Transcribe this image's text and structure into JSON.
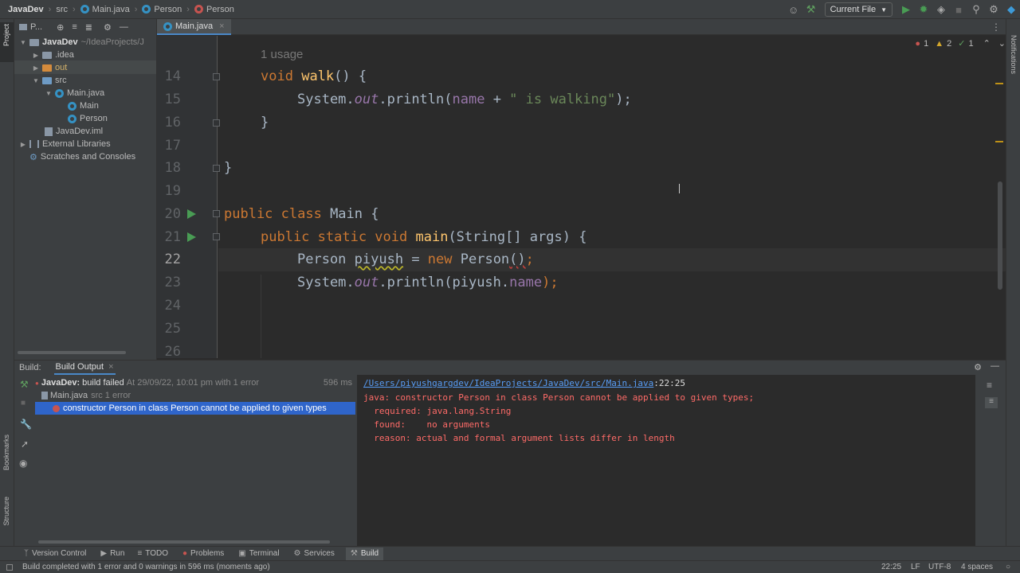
{
  "breadcrumb": {
    "project": "JavaDev",
    "folder": "src",
    "file": "Main.java",
    "class1": "Person",
    "class2": "Person"
  },
  "toolbar": {
    "run_config": "Current File"
  },
  "left_strip": {
    "project_label": "Project",
    "bookmarks_label": "Bookmarks",
    "structure_label": "Structure"
  },
  "right_strip": {
    "notifications_label": "Notifications"
  },
  "project_panel": {
    "title": "P...",
    "items": [
      {
        "label": "JavaDev",
        "detail": "~/IdeaProjects/J"
      },
      {
        "label": ".idea"
      },
      {
        "label": "out"
      },
      {
        "label": "src"
      },
      {
        "label": "Main.java"
      },
      {
        "label": "Main"
      },
      {
        "label": "Person"
      },
      {
        "label": "JavaDev.iml"
      },
      {
        "label": "External Libraries"
      },
      {
        "label": "Scratches and Consoles"
      }
    ]
  },
  "editor_tab": {
    "label": "Main.java"
  },
  "inspection": {
    "errors": "1",
    "warnings": "2",
    "ok": "1"
  },
  "editor": {
    "usage_hint": "1 usage",
    "line_numbers": [
      "14",
      "15",
      "16",
      "17",
      "18",
      "19",
      "20",
      "21",
      "22",
      "23",
      "24",
      "25",
      "26"
    ],
    "lines": {
      "l14_kw": "void",
      "l14_fn": "walk",
      "l14_rest": "() {",
      "l15_a": "System.",
      "l15_out": "out",
      "l15_b": ".println(",
      "l15_name": "name",
      "l15_c": " + ",
      "l15_str": "\" is walking\"",
      "l15_d": ");",
      "l16": "}",
      "l18": "}",
      "l20_kw": "public class",
      "l20_rest": " Main {",
      "l21_kw": "public static void",
      "l21_fn": "main",
      "l21_rest": "(String[] args) {",
      "l22_a": "Person ",
      "l22_var": "piyush",
      "l22_b": " = ",
      "l22_new": "new",
      "l22_c": " Person",
      "l22_paren": "()",
      "l22_d": ";",
      "l23_a": "System.",
      "l23_out": "out",
      "l23_b": ".println(piyush.",
      "l23_name": "name",
      "l23_c": ");"
    }
  },
  "build_panel": {
    "label": "Build:",
    "tab": "Build Output",
    "root": "JavaDev:",
    "root_status": "build failed",
    "root_detail": "At 29/09/22, 10:01 pm with 1 error",
    "root_time": "596 ms",
    "file": "Main.java",
    "file_detail": "src 1 error",
    "error_item": "constructor Person in class Person cannot be applied to given types",
    "output_link": "/Users/piyushgargdev/IdeaProjects/JavaDev/src/Main.java",
    "output_pos": ":22:25",
    "output_lines": [
      "java: constructor Person in class Person cannot be applied to given types;",
      "  required: java.lang.String",
      "  found:    no arguments",
      "  reason: actual and formal argument lists differ in length"
    ]
  },
  "tool_windows": [
    "Version Control",
    "Run",
    "TODO",
    "Problems",
    "Terminal",
    "Services",
    "Build"
  ],
  "status": {
    "message": "Build completed with 1 error and 0 warnings in 596 ms (moments ago)",
    "position": "22:25",
    "line_sep": "LF",
    "encoding": "UTF-8",
    "indent": "4 spaces"
  },
  "colors": {
    "accent": "#4a88c7",
    "error": "#c75450",
    "run": "#499c54",
    "selection": "#2f65ca"
  }
}
